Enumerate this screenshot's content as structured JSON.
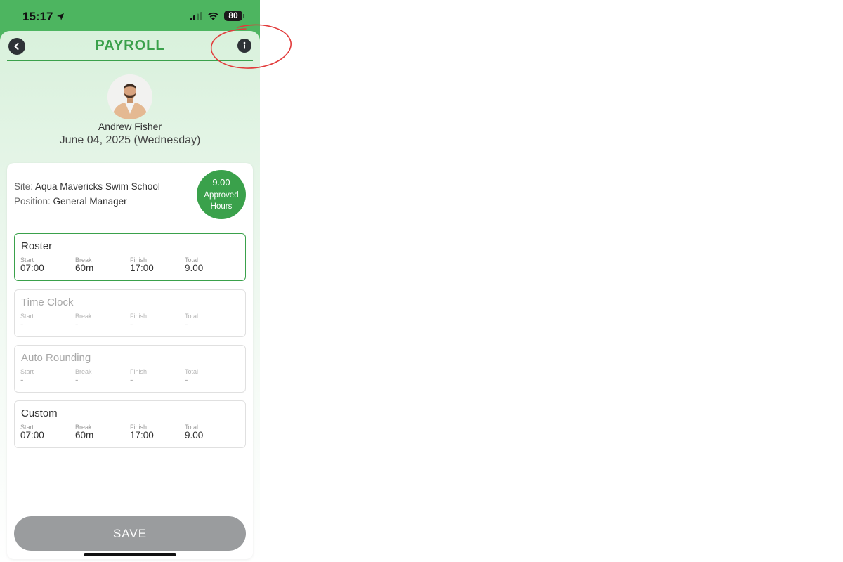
{
  "status_bar": {
    "time": "15:17",
    "battery": "80"
  },
  "header": {
    "title": "PAYROLL"
  },
  "employee": {
    "name": "Andrew Fisher",
    "date": "June 04, 2025 (Wednesday)"
  },
  "details": {
    "site_label": "Site:",
    "site_value": "Aqua Mavericks Swim School",
    "position_label": "Position:",
    "position_value": "General Manager"
  },
  "approved": {
    "value": "9.00",
    "label": "Approved Hours"
  },
  "column_labels": {
    "start": "Start",
    "break": "Break",
    "finish": "Finish",
    "total": "Total"
  },
  "options": [
    {
      "title": "Roster",
      "start": "07:00",
      "break": "60m",
      "finish": "17:00",
      "total": "9.00",
      "selected": true
    },
    {
      "title": "Time Clock",
      "start": "-",
      "break": "-",
      "finish": "-",
      "total": "-",
      "selected": false
    },
    {
      "title": "Auto Rounding",
      "start": "-",
      "break": "-",
      "finish": "-",
      "total": "-",
      "selected": false
    },
    {
      "title": "Custom",
      "start": "07:00",
      "break": "60m",
      "finish": "17:00",
      "total": "9.00",
      "selected": false
    }
  ],
  "save_label": "SAVE",
  "colors": {
    "accent": "#3aa14b",
    "status_green": "#4db560",
    "annotation_red": "#e23b3b",
    "save_disabled": "#9a9c9e"
  }
}
